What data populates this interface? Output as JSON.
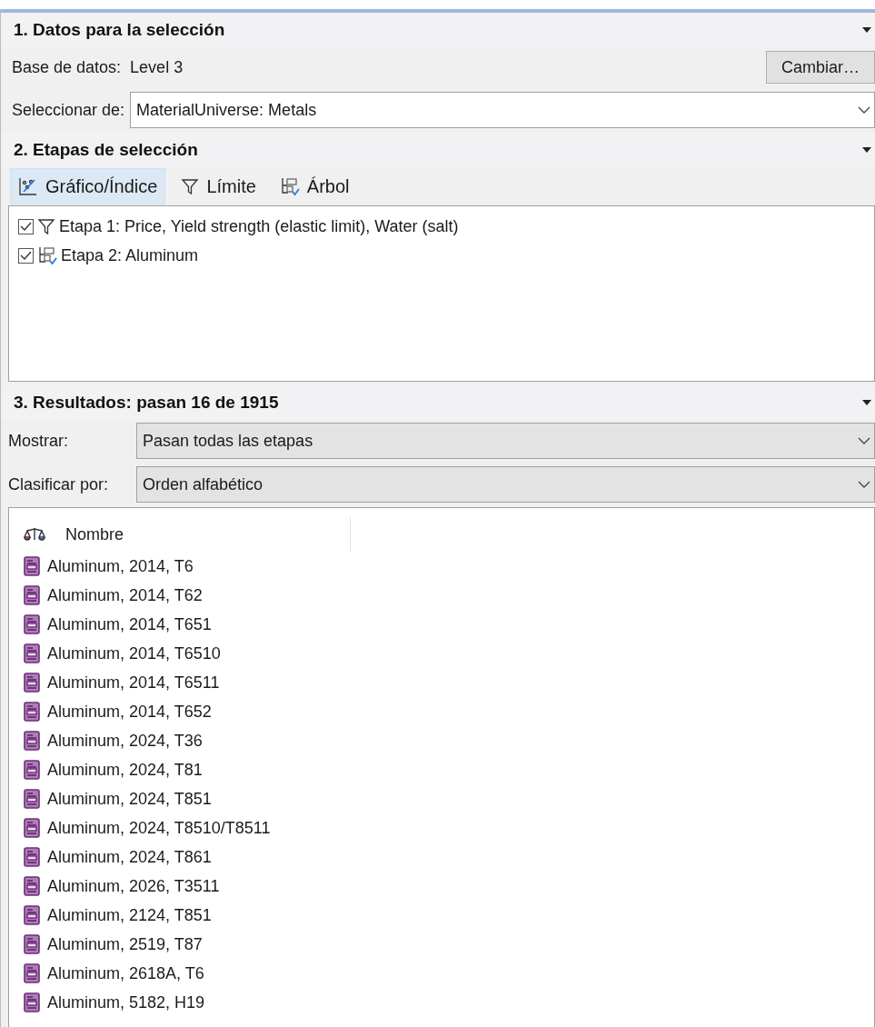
{
  "section_1": {
    "title": "1. Datos para la selección",
    "database_label": "Base de datos:",
    "database_value": "Level 3",
    "change_button": "Cambiar…",
    "select_from_label": "Seleccionar de:",
    "select_from_value": "MaterialUniverse: Metals"
  },
  "section_2": {
    "title": "2. Etapas de selección",
    "tools": [
      {
        "kind": "chart",
        "label": "Gráfico/Índice",
        "selected": true
      },
      {
        "kind": "filter",
        "label": "Límite",
        "selected": false
      },
      {
        "kind": "tree",
        "label": "Árbol",
        "selected": false
      }
    ],
    "stages": [
      {
        "kind": "filter",
        "label": "Etapa 1: Price, Yield strength (elastic limit), Water (salt)",
        "checked": true
      },
      {
        "kind": "tree",
        "label": "Etapa 2: Aluminum",
        "checked": true
      }
    ]
  },
  "section_3": {
    "title": "3. Resultados: pasan 16 de 1915",
    "show_label": "Mostrar:",
    "show_value": "Pasan todas las etapas",
    "sort_label": "Clasificar por:",
    "sort_value": "Orden alfabético",
    "column": "Nombre",
    "rows": [
      "Aluminum, 2014, T6",
      "Aluminum, 2014, T62",
      "Aluminum, 2014, T651",
      "Aluminum, 2014, T6510",
      "Aluminum, 2014, T6511",
      "Aluminum, 2014, T652",
      "Aluminum, 2024, T36",
      "Aluminum, 2024, T81",
      "Aluminum, 2024, T851",
      "Aluminum, 2024, T8510/T8511",
      "Aluminum, 2024, T861",
      "Aluminum, 2026, T3511",
      "Aluminum, 2124, T851",
      "Aluminum, 2519, T87",
      "Aluminum, 2618A, T6",
      "Aluminum, 5182, H19"
    ]
  }
}
